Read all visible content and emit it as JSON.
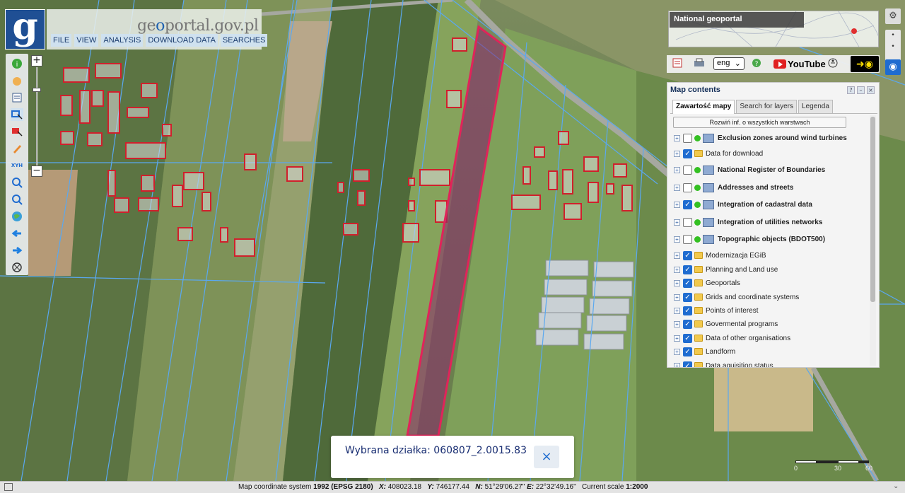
{
  "brand": {
    "logo_letter": "g",
    "name_prefix": "ge",
    "name_accent": "o",
    "name_rest": "portal",
    "name_suffix": ".gov.pl"
  },
  "menu": {
    "items": [
      "FILE",
      "VIEW",
      "ANALYSIS",
      "DOWNLOAD DATA",
      "SEARCHES"
    ]
  },
  "toolbar": {
    "icons": [
      "info-icon",
      "pan-hand-icon",
      "layers-list-icon",
      "select-icon",
      "select-area-icon",
      "pencil-icon",
      "xyz-icon",
      "zoom-in-icon",
      "zoom-out-icon",
      "globe-icon",
      "back-arrow-icon",
      "forward-arrow-icon",
      "reset-icon"
    ],
    "xyz_label": "XYH"
  },
  "zoom": {
    "plus": "+",
    "minus": "−"
  },
  "minimap": {
    "label": "National geoportal"
  },
  "toolrow": {
    "language": "eng",
    "youtube": "YouTube"
  },
  "panel": {
    "title": "Map contents",
    "controls": [
      "?",
      "–",
      "×"
    ],
    "tabs": [
      {
        "label": "Zawartość mapy",
        "active": true
      },
      {
        "label": "Search for layers",
        "active": false
      },
      {
        "label": "Legenda",
        "active": false
      }
    ],
    "expand_button": "Rozwiń inf. o wszystkich warstwach",
    "layers": [
      {
        "label": "Exclusion zones around wind turbines",
        "checked": false,
        "kind": "wms",
        "bold": true
      },
      {
        "label": "Data for download",
        "checked": true,
        "kind": "folder",
        "bold": false
      },
      {
        "label": "National Register of Boundaries",
        "checked": false,
        "kind": "wms",
        "bold": true
      },
      {
        "label": "Addresses and streets",
        "checked": false,
        "kind": "wms",
        "bold": true
      },
      {
        "label": "Integration of cadastral data",
        "checked": true,
        "kind": "wms",
        "bold": true
      },
      {
        "label": "Integration of utilities networks",
        "checked": false,
        "kind": "wms",
        "bold": true
      },
      {
        "label": "Topographic objects (BDOT500)",
        "checked": false,
        "kind": "wms",
        "bold": true
      },
      {
        "label": "Modernizacja EGiB",
        "checked": true,
        "kind": "folder",
        "bold": false
      },
      {
        "label": "Planning and Land use",
        "checked": true,
        "kind": "folder",
        "bold": false
      },
      {
        "label": "Geoportals",
        "checked": true,
        "kind": "folder",
        "bold": false
      },
      {
        "label": "Grids and coordinate systems",
        "checked": true,
        "kind": "folder",
        "bold": false
      },
      {
        "label": "Points of interest",
        "checked": true,
        "kind": "folder",
        "bold": false
      },
      {
        "label": "Govermental programs",
        "checked": true,
        "kind": "folder",
        "bold": false
      },
      {
        "label": "Data of other organisations",
        "checked": true,
        "kind": "folder",
        "bold": false
      },
      {
        "label": "Landform",
        "checked": true,
        "kind": "folder",
        "bold": false
      },
      {
        "label": "Data aquisition status",
        "checked": true,
        "kind": "folder",
        "bold": false
      }
    ]
  },
  "popup": {
    "text": "Wybrana działka: 060807_2.0015.83",
    "close": "×"
  },
  "scalebar": {
    "labels": [
      "0",
      "30",
      "60"
    ]
  },
  "status": {
    "prefix": "Map coordinate system",
    "system": "1992 (EPSG 2180)",
    "x_label": "X:",
    "x_value": "408023.18",
    "y_label": "Y:",
    "y_value": "746177.44",
    "n_label": "N:",
    "n_value": "51°29'06.27\"",
    "e_label": "E:",
    "e_value": "22°32'49.16\"",
    "scale_label": "Current scale",
    "scale_value": "1:2000"
  },
  "colors": {
    "parcel_highlight": "#e0245a",
    "building_outline": "#d0202c",
    "parcel_lines": "#5aa8f0",
    "accent_blue": "#1f6cd0"
  }
}
